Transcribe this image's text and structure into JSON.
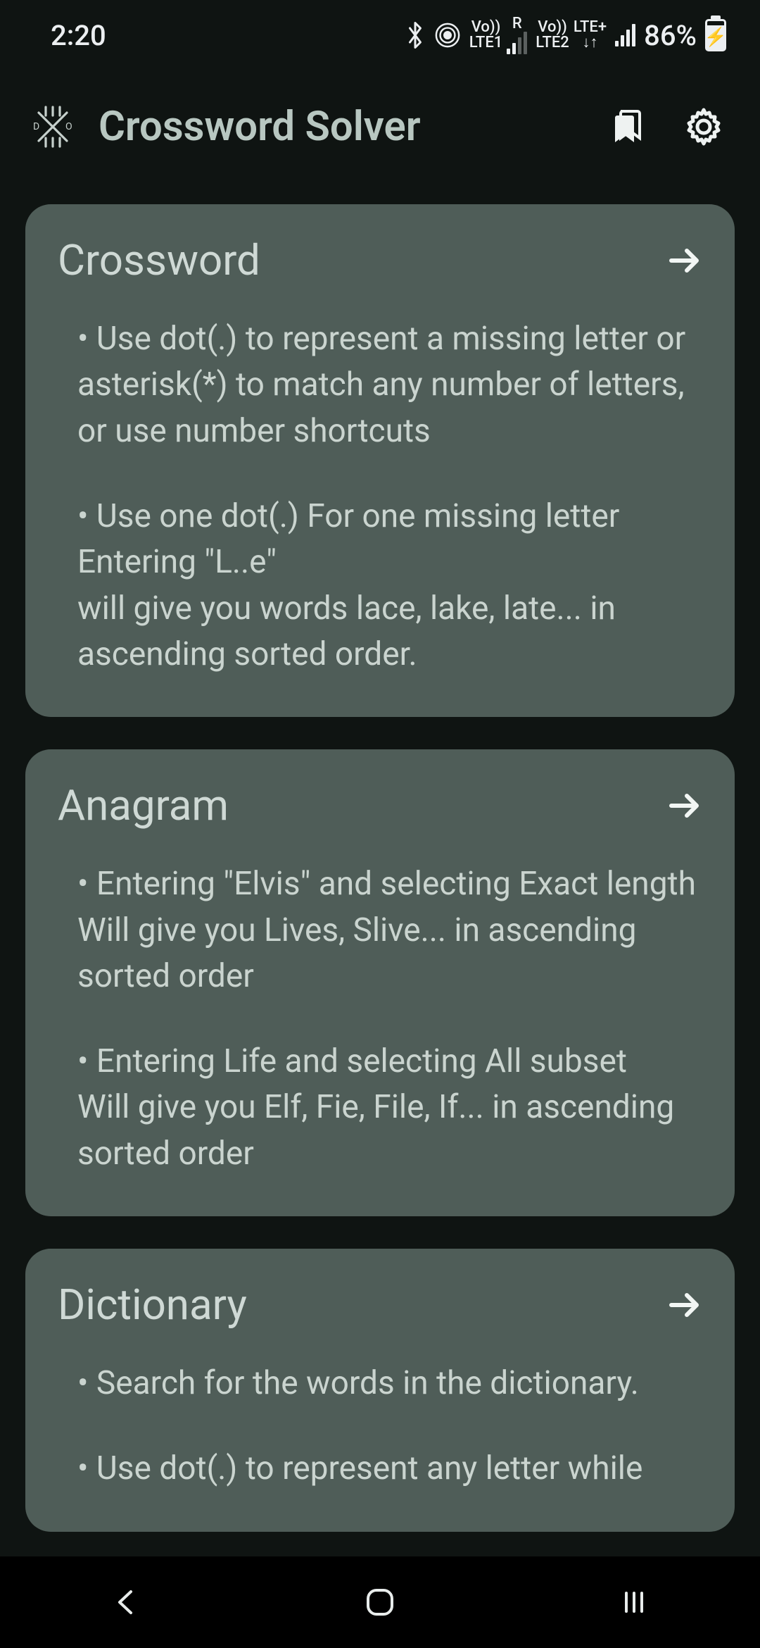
{
  "status": {
    "time": "2:20",
    "lte1_top": "Vo))",
    "lte1_bottom": "LTE1",
    "lte1_side": "R",
    "lte2_top": "Vo))",
    "lte2_bottom": "LTE2",
    "lte2_side": "LTE+",
    "battery": "86%"
  },
  "header": {
    "title": "Crossword Solver"
  },
  "cards": [
    {
      "title": "Crossword",
      "bullets": [
        "• Use dot(.) to represent a missing letter or asterisk(*) to match any number of letters, or use number shortcuts",
        "• Use one dot(.) For one missing letter Entering \"L..e\"\nwill give you words lace, lake, late... in ascending sorted order."
      ]
    },
    {
      "title": "Anagram",
      "bullets": [
        "• Entering \"Elvis\" and selecting Exact length\nWill give you Lives, Slive... in ascending sorted order",
        "• Entering Life and selecting All subset\nWill give you Elf, Fie, File, If... in ascending sorted order"
      ]
    },
    {
      "title": "Dictionary",
      "bullets": [
        "• Search for the words in the dictionary.",
        "• Use dot(.) to represent any letter while"
      ]
    }
  ]
}
